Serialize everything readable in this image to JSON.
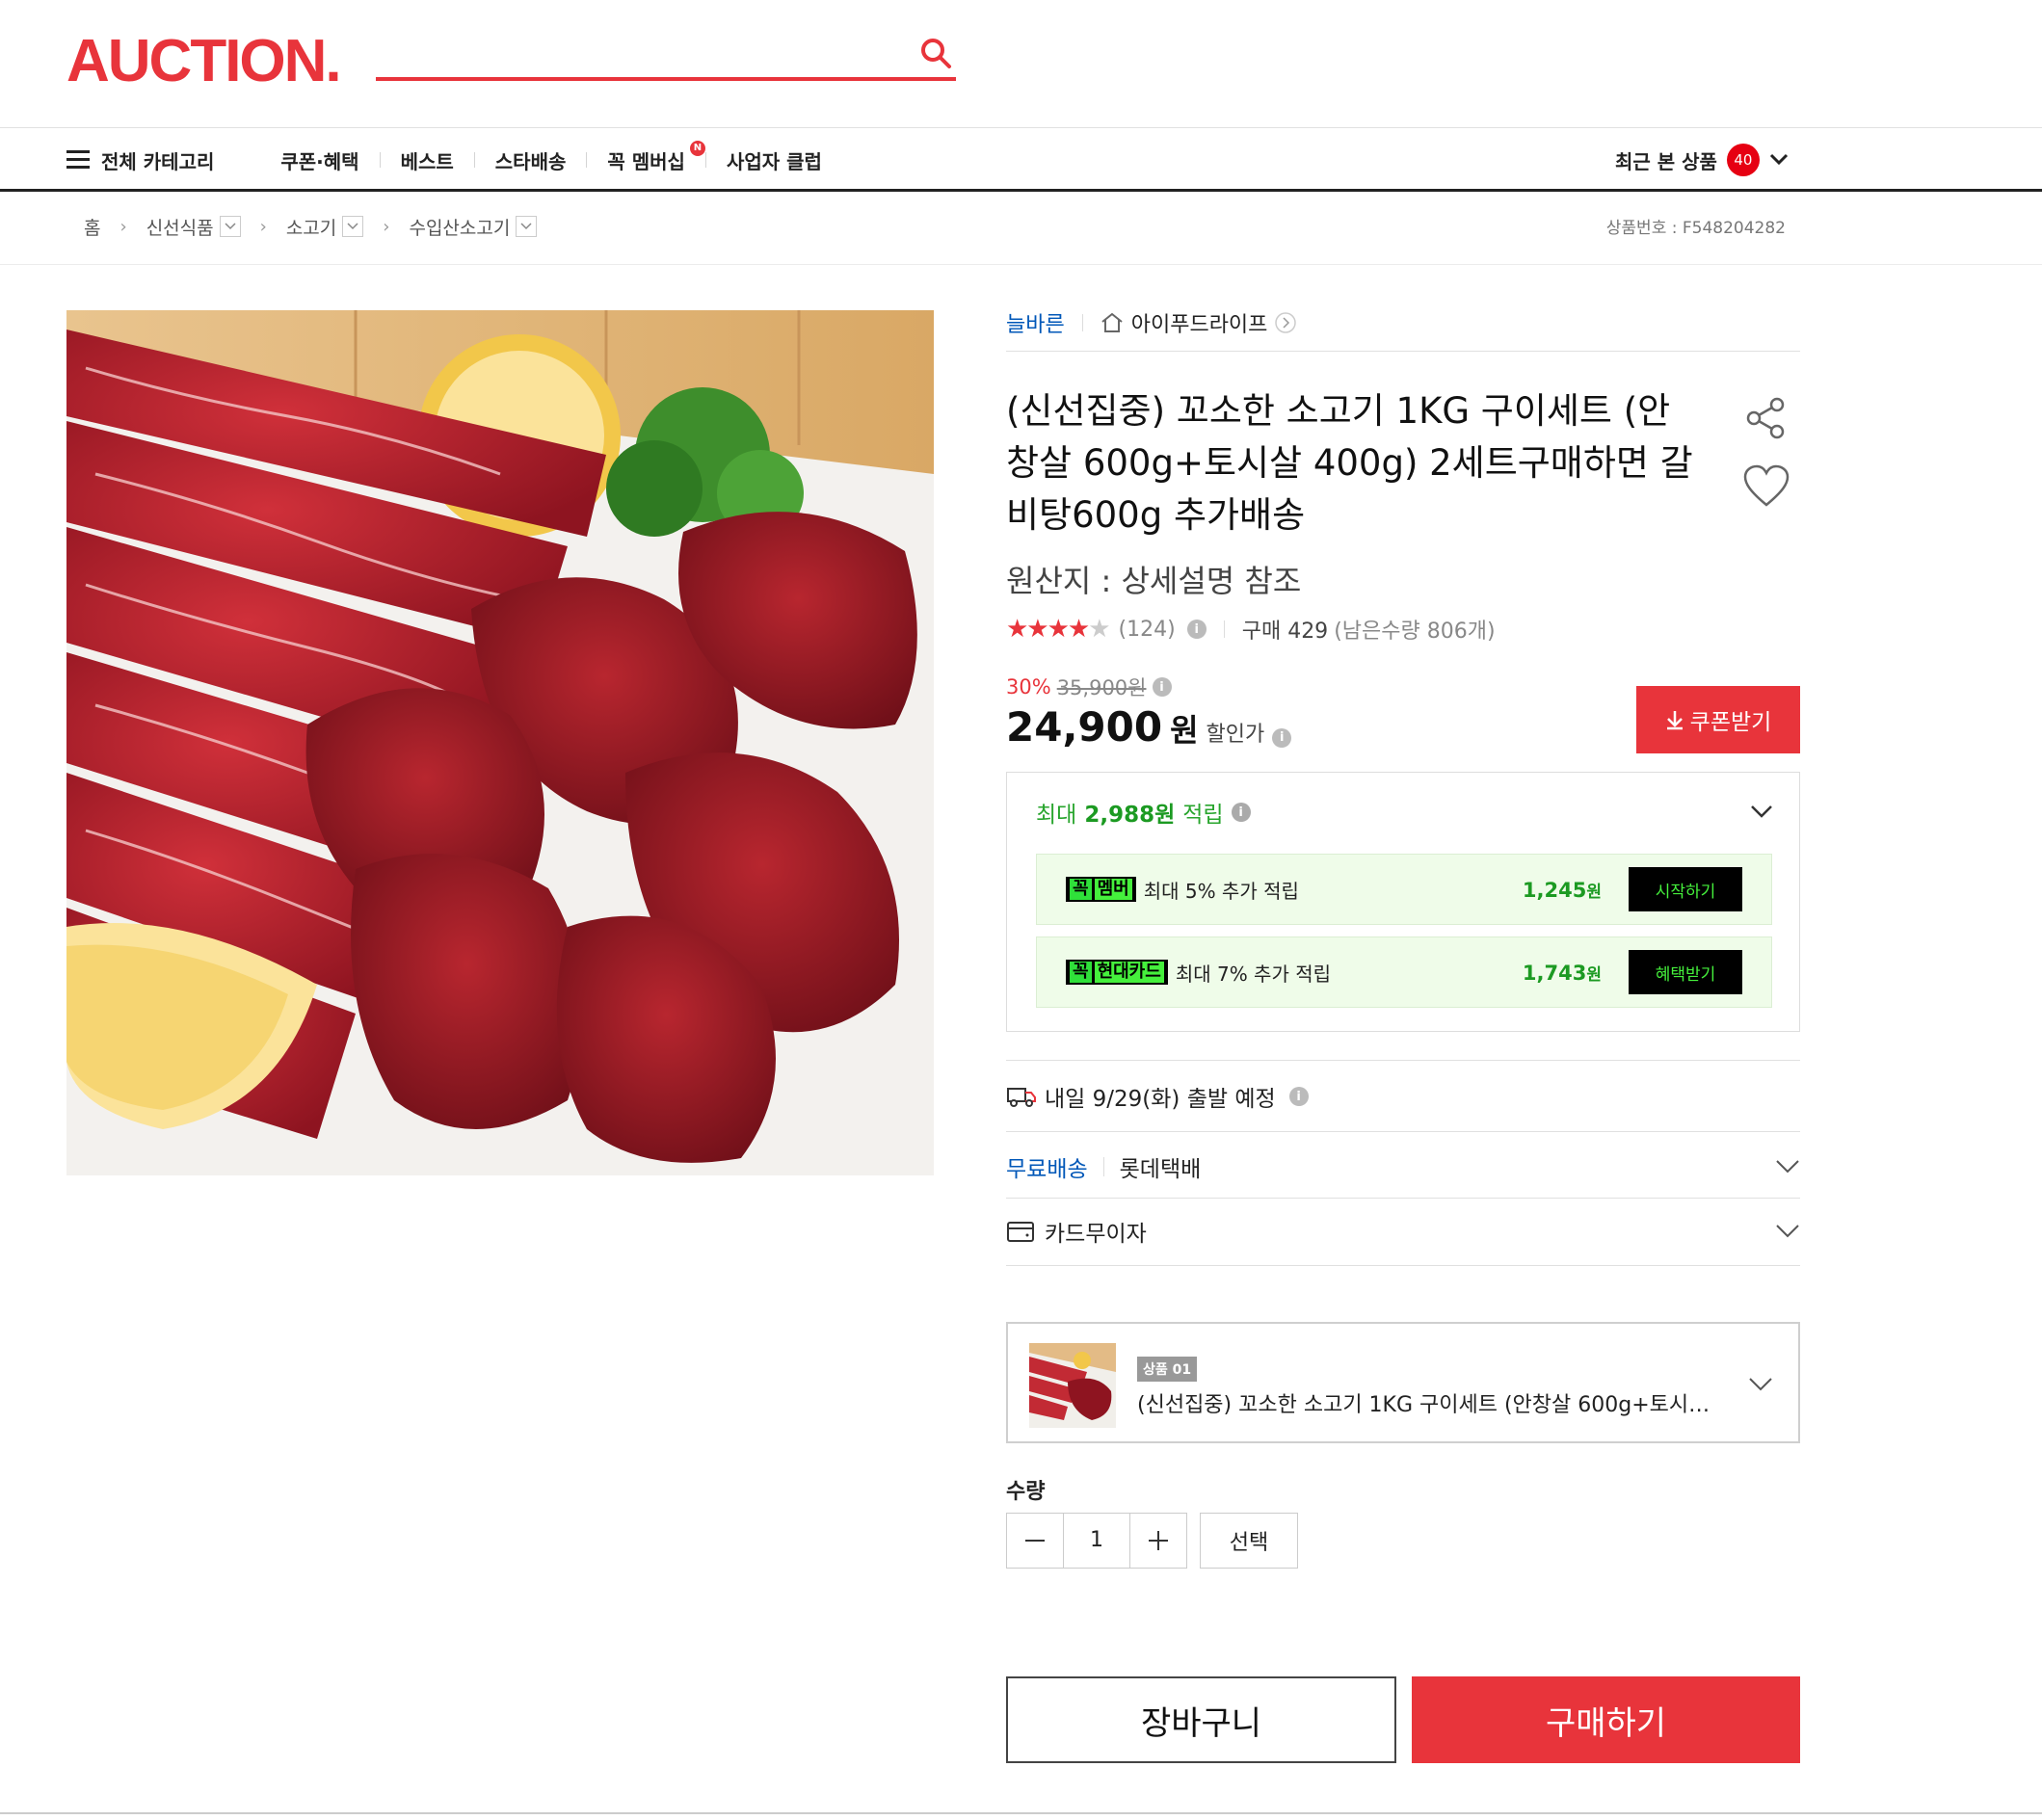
{
  "header": {
    "logo_text": "AUCTION.",
    "search_placeholder": "",
    "search_value": ""
  },
  "gnb": {
    "all_category": "전체 카테고리",
    "items": [
      "쿠폰·혜택",
      "베스트",
      "스타배송",
      "꼭 멤버십",
      "사업자 클럽"
    ],
    "new_badge": "N",
    "recent_label": "최근 본 상품",
    "recent_count": "40"
  },
  "breadcrumb": {
    "home": "홈",
    "levels": [
      "신선식품",
      "소고기",
      "수입산소고기"
    ]
  },
  "product_no": "상품번호 : F548204282",
  "brand": "늘바른",
  "shop_name": "아이푸드라이프",
  "title": "(신선집중) 꼬소한 소고기 1KG 구이세트 (안창살 600g+토시살 400g) 2세트구매하면 갈비탕600g 추가배송",
  "origin": "원산지 : 상세설명 참조",
  "rating": {
    "stars_on": "★★★★",
    "stars_off": "★",
    "score": 4,
    "count": "(124)",
    "purchase_label": "구매 429",
    "stock": "(남은수량 806개)"
  },
  "price": {
    "discount": "30%",
    "original": "35,900원",
    "sale": "24,900",
    "unit": "원",
    "label": "할인가"
  },
  "coupon_button": "쿠폰받기",
  "points": {
    "prefix": "최대",
    "amount": "2,988원",
    "suffix": "적립",
    "benefits": [
      {
        "tag1": "꼭",
        "tag2": "멤버",
        "text": "최대 5% 추가 적립",
        "amount": "1,245",
        "unit": "원",
        "button": "시작하기"
      },
      {
        "tag1": "꼭",
        "tag2": "현대카드",
        "text": "최대 7% 추가 적립",
        "amount": "1,743",
        "unit": "원",
        "button": "혜택받기"
      }
    ]
  },
  "shipping": {
    "departure": "내일 9/29(화) 출발 예정",
    "free": "무료배송",
    "carrier": "롯데택배",
    "card": "카드무이자"
  },
  "option": {
    "tag": "상품 01",
    "name": "(신선집중) 꼬소한 소고기 1KG 구이세트 (안창살 600g+토시살 ..."
  },
  "quantity": {
    "label": "수량",
    "value": "1",
    "select": "선택"
  },
  "buttons": {
    "cart": "장바구니",
    "buy": "구매하기"
  },
  "colors": {
    "brand_red": "#e8343b",
    "point_green": "#1c9a22",
    "link_blue": "#0057b8"
  }
}
